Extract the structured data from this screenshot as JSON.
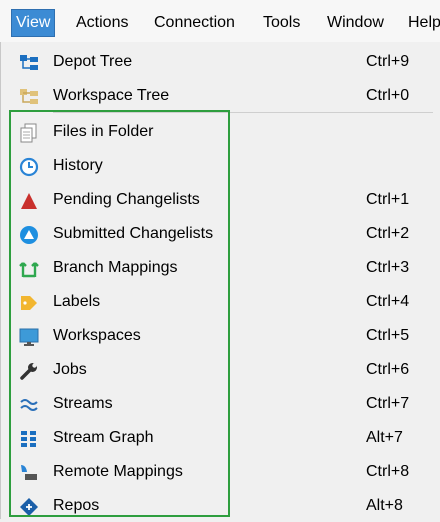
{
  "menubar": [
    {
      "label": "View",
      "active": true
    },
    {
      "label": "Actions"
    },
    {
      "label": "Connection"
    },
    {
      "label": "Tools"
    },
    {
      "label": "Window"
    },
    {
      "label": "Help"
    }
  ],
  "menu": {
    "items": [
      {
        "label": "Depot Tree",
        "shortcut": "Ctrl+9",
        "icon": "depot-tree-icon"
      },
      {
        "label": "Workspace Tree",
        "shortcut": "Ctrl+0",
        "icon": "workspace-tree-icon"
      },
      {
        "label": "Files in Folder",
        "shortcut": "",
        "icon": "files-icon"
      },
      {
        "label": "History",
        "shortcut": "",
        "icon": "clock-icon"
      },
      {
        "label": "Pending Changelists",
        "shortcut": "Ctrl+1",
        "icon": "triangle-icon"
      },
      {
        "label": "Submitted Changelists",
        "shortcut": "Ctrl+2",
        "icon": "submitted-icon"
      },
      {
        "label": "Branch Mappings",
        "shortcut": "Ctrl+3",
        "icon": "branch-icon"
      },
      {
        "label": "Labels",
        "shortcut": "Ctrl+4",
        "icon": "tag-icon"
      },
      {
        "label": "Workspaces",
        "shortcut": "Ctrl+5",
        "icon": "monitor-icon"
      },
      {
        "label": "Jobs",
        "shortcut": "Ctrl+6",
        "icon": "wrench-icon"
      },
      {
        "label": "Streams",
        "shortcut": "Ctrl+7",
        "icon": "streams-icon"
      },
      {
        "label": "Stream Graph",
        "shortcut": "Alt+7",
        "icon": "stream-graph-icon"
      },
      {
        "label": "Remote Mappings",
        "shortcut": "Ctrl+8",
        "icon": "remote-mappings-icon"
      },
      {
        "label": "Repos",
        "shortcut": "Alt+8",
        "icon": "repos-icon"
      }
    ]
  },
  "colors": {
    "menu_highlight": "#3c8bd4",
    "box_outline": "#2e9e3e"
  }
}
